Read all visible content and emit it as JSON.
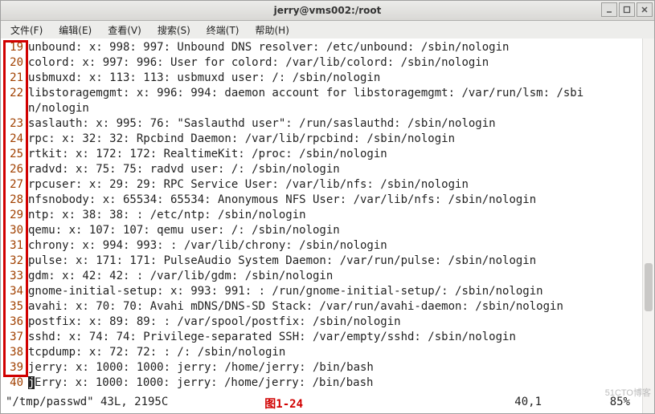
{
  "window": {
    "title": "jerry@vms002:/root"
  },
  "menu": {
    "file": "文件(F)",
    "edit": "编辑(E)",
    "view": "查看(V)",
    "search": "搜索(S)",
    "terminal": "终端(T)",
    "help": "帮助(H)"
  },
  "lines": [
    {
      "n": "19",
      "t": "unbound: x: 998: 997: Unbound DNS resolver: /etc/unbound: /sbin/nologin"
    },
    {
      "n": "20",
      "t": "colord: x: 997: 996: User for colord: /var/lib/colord: /sbin/nologin"
    },
    {
      "n": "21",
      "t": "usbmuxd: x: 113: 113: usbmuxd user: /: /sbin/nologin"
    },
    {
      "n": "22",
      "t": "libstoragemgmt: x: 996: 994: daemon account for libstoragemgmt: /var/run/lsm: /sbi"
    },
    {
      "n": "",
      "t": "n/nologin"
    },
    {
      "n": "23",
      "t": "saslauth: x: 995: 76: \"Saslauthd user\": /run/saslauthd: /sbin/nologin"
    },
    {
      "n": "24",
      "t": "rpc: x: 32: 32: Rpcbind Daemon: /var/lib/rpcbind: /sbin/nologin"
    },
    {
      "n": "25",
      "t": "rtkit: x: 172: 172: RealtimeKit: /proc: /sbin/nologin"
    },
    {
      "n": "26",
      "t": "radvd: x: 75: 75: radvd user: /: /sbin/nologin"
    },
    {
      "n": "27",
      "t": "rpcuser: x: 29: 29: RPC Service User: /var/lib/nfs: /sbin/nologin"
    },
    {
      "n": "28",
      "t": "nfsnobody: x: 65534: 65534: Anonymous NFS User: /var/lib/nfs: /sbin/nologin"
    },
    {
      "n": "29",
      "t": "ntp: x: 38: 38: : /etc/ntp: /sbin/nologin"
    },
    {
      "n": "30",
      "t": "qemu: x: 107: 107: qemu user: /: /sbin/nologin"
    },
    {
      "n": "31",
      "t": "chrony: x: 994: 993: : /var/lib/chrony: /sbin/nologin"
    },
    {
      "n": "32",
      "t": "pulse: x: 171: 171: PulseAudio System Daemon: /var/run/pulse: /sbin/nologin"
    },
    {
      "n": "33",
      "t": "gdm: x: 42: 42: : /var/lib/gdm: /sbin/nologin"
    },
    {
      "n": "34",
      "t": "gnome-initial-setup: x: 993: 991: : /run/gnome-initial-setup/: /sbin/nologin"
    },
    {
      "n": "35",
      "t": "avahi: x: 70: 70: Avahi mDNS/DNS-SD Stack: /var/run/avahi-daemon: /sbin/nologin"
    },
    {
      "n": "36",
      "t": "postfix: x: 89: 89: : /var/spool/postfix: /sbin/nologin"
    },
    {
      "n": "37",
      "t": "sshd: x: 74: 74: Privilege-separated SSH: /var/empty/sshd: /sbin/nologin"
    },
    {
      "n": "38",
      "t": "tcpdump: x: 72: 72: : /: /sbin/nologin"
    },
    {
      "n": "39",
      "t": "jerry: x: 1000: 1000: jerry: /home/jerry: /bin/bash"
    },
    {
      "n": "40",
      "t": "Erry: x: 1000: 1000: jerry: /home/jerry: /bin/bash",
      "cursor_prefix": "j"
    }
  ],
  "status": {
    "filename": "\"/tmp/passwd\" 43L, 2195C",
    "figure_label": "图1-24",
    "position": "40,1",
    "percent": "85%"
  },
  "watermark": "51CTO博客"
}
